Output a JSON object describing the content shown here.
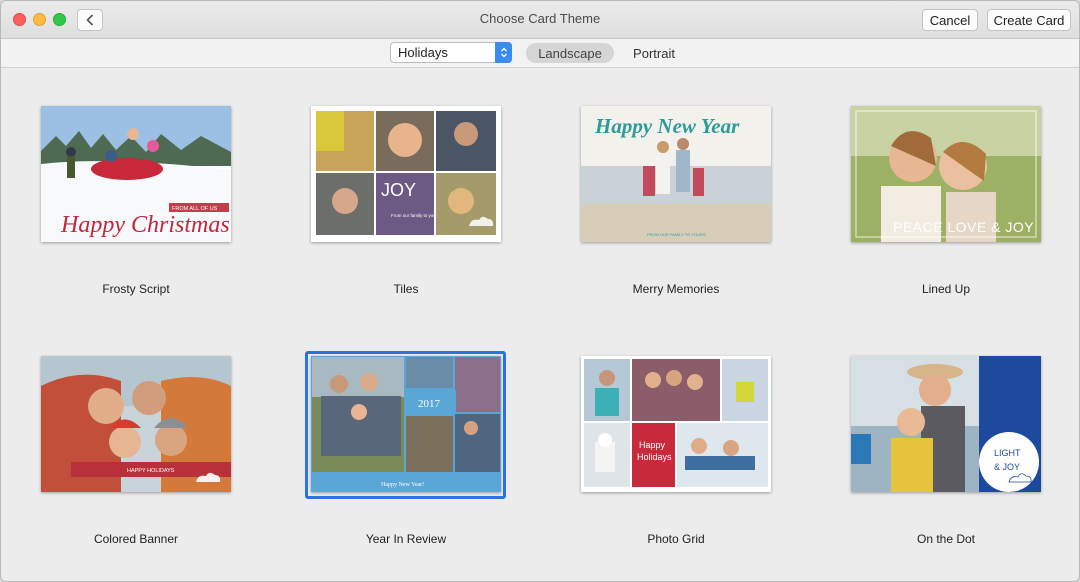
{
  "window": {
    "title": "Choose Card Theme",
    "cancel_label": "Cancel",
    "create_label": "Create Card"
  },
  "toolbar": {
    "occasion_selected": "Holidays",
    "orientation_options": [
      "Landscape",
      "Portrait"
    ],
    "orientation_selected": "Landscape"
  },
  "themes": [
    {
      "name": "Frosty Script",
      "card_text": [
        "FROM ALL OF US",
        "Happy Christmas"
      ]
    },
    {
      "name": "Tiles",
      "card_text": [
        "JOY",
        "From our family to yours"
      ]
    },
    {
      "name": "Merry Memories",
      "card_text": [
        "Happy New Year",
        "FROM OUR FAMILY TO YOURS"
      ]
    },
    {
      "name": "Lined Up",
      "card_text": [
        "PEACE LOVE & JOY"
      ]
    },
    {
      "name": "Colored Banner",
      "card_text": [
        "HAPPY HOLIDAYS"
      ]
    },
    {
      "name": "Year In Review",
      "card_text": [
        "2017",
        "Happy New Year!"
      ],
      "selected": true
    },
    {
      "name": "Photo Grid",
      "card_text": [
        "Happy",
        "Holidays"
      ]
    },
    {
      "name": "On the Dot",
      "card_text": [
        "LIGHT",
        "& JOY"
      ]
    }
  ],
  "colors": {
    "accent": "#2a74e0",
    "tiles_purple": "#6d5a84",
    "merry_teal": "#2f9a9a",
    "banner_red": "#b8313a",
    "review_blue": "#5aa6d6",
    "grid_red": "#c8293b",
    "dot_blue": "#1d4a9c"
  }
}
